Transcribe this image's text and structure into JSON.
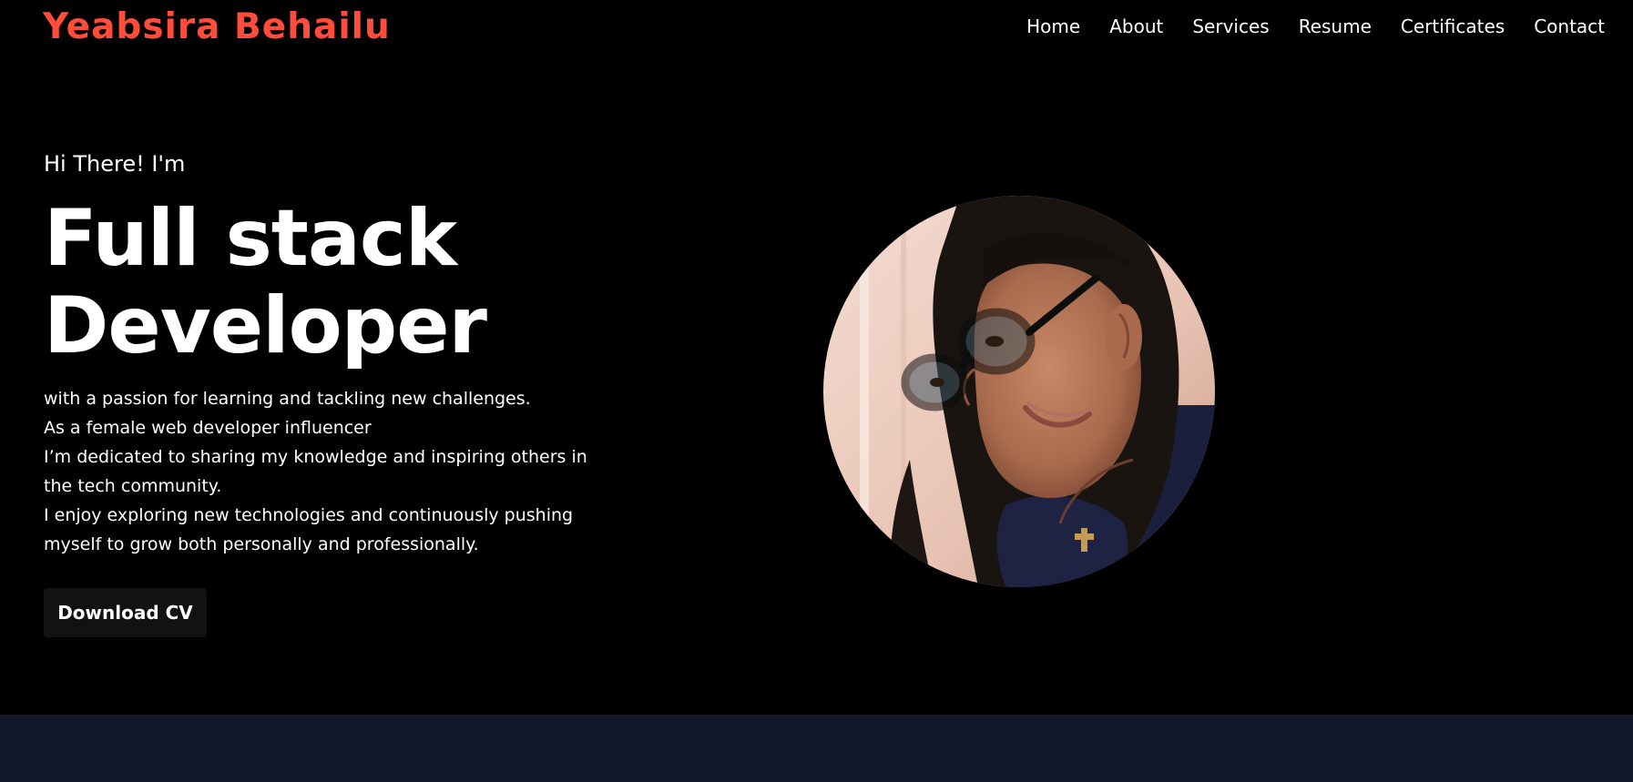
{
  "header": {
    "brand": "Yeabsira Behailu",
    "nav": [
      {
        "label": "Home"
      },
      {
        "label": "About"
      },
      {
        "label": "Services"
      },
      {
        "label": "Resume"
      },
      {
        "label": "Certificates"
      },
      {
        "label": "Contact"
      }
    ]
  },
  "hero": {
    "greeting": "Hi There! I'm",
    "headline": [
      "Full stack",
      "Developer"
    ],
    "bio_lines": [
      "with a passion for learning and tackling new challenges.",
      "As a female web developer influencer",
      "I’m dedicated to sharing my knowledge and inspiring others in the tech community.",
      "I enjoy exploring new technologies and continuously pushing myself to grow both personally and professionally."
    ],
    "cv_button": "Download CV"
  },
  "colors": {
    "background": "#000000",
    "brand": "#ff4c3b",
    "text": "#ffffff",
    "button": "#121212",
    "next_section": "#121729"
  }
}
